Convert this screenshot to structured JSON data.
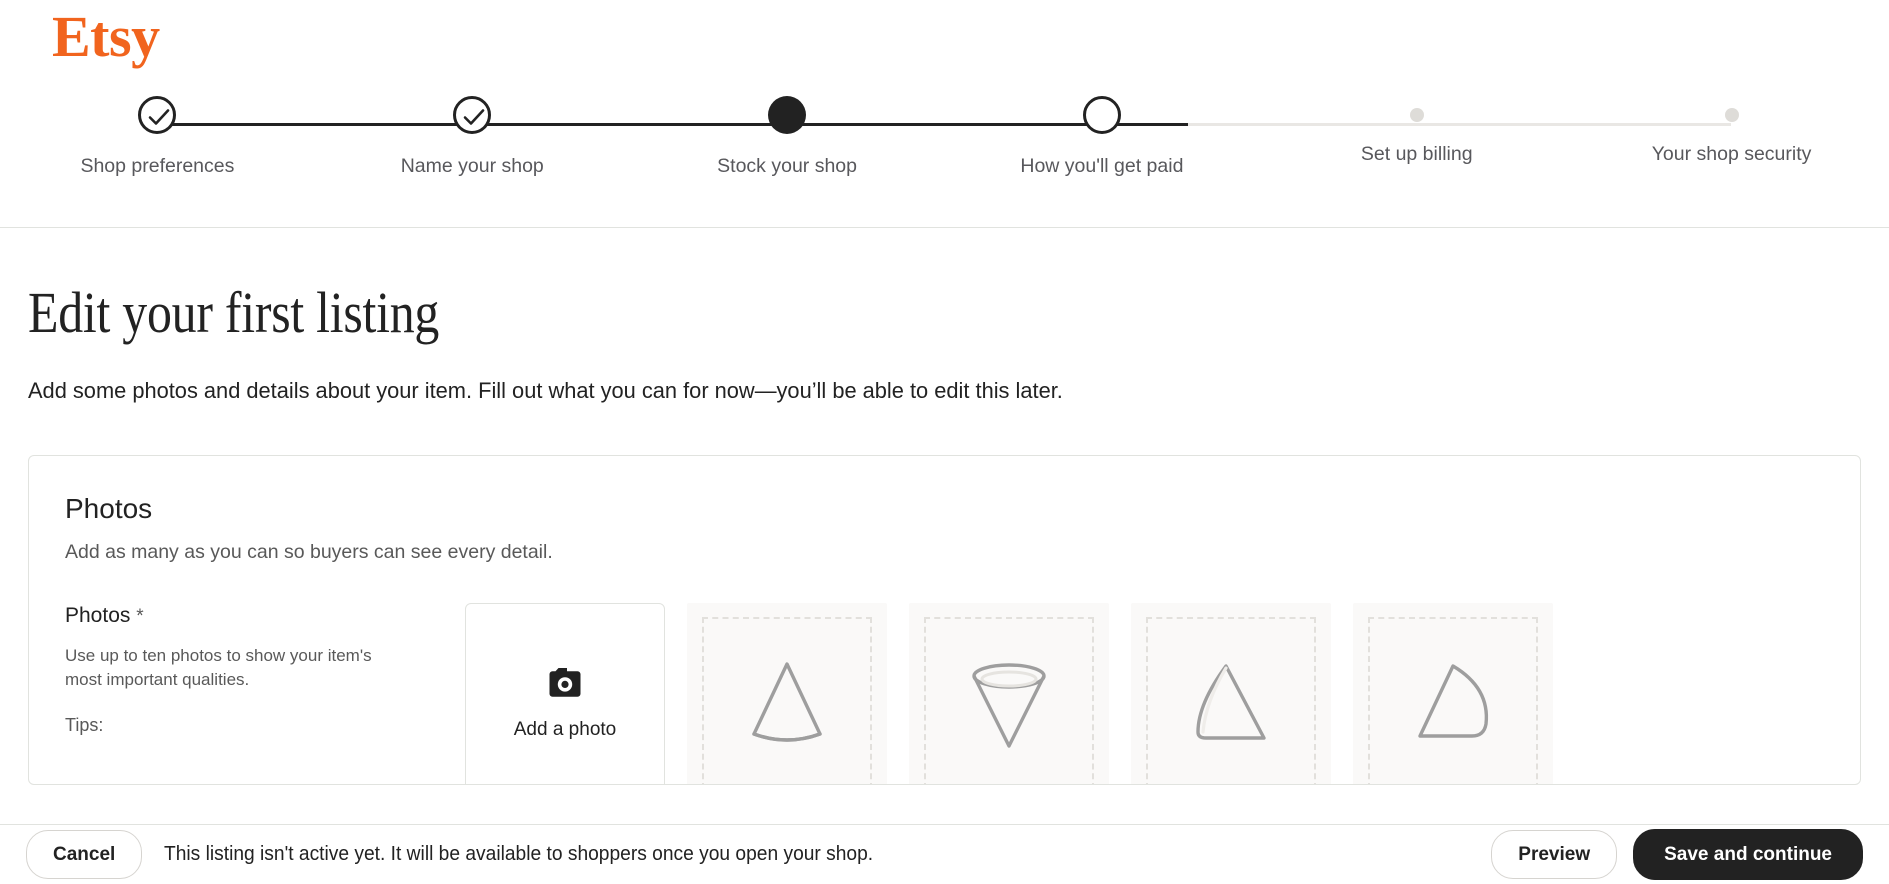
{
  "brand": {
    "name": "Etsy",
    "color": "#F1641E"
  },
  "stepper": {
    "steps": [
      {
        "label": "Shop preferences",
        "state": "complete"
      },
      {
        "label": "Name your shop",
        "state": "complete"
      },
      {
        "label": "Stock your shop",
        "state": "current"
      },
      {
        "label": "How you'll get paid",
        "state": "next"
      },
      {
        "label": "Set up billing",
        "state": "future"
      },
      {
        "label": "Your shop security",
        "state": "future"
      }
    ]
  },
  "page": {
    "title": "Edit your first listing",
    "subtitle": "Add some photos and details about your item. Fill out what you can for now—you’ll be able to edit this later."
  },
  "photos_card": {
    "title": "Photos",
    "description": "Add as many as you can so buyers can see every detail.",
    "field": {
      "label": "Photos",
      "required_mark": "*",
      "help": "Use up to ten photos to show your item's most important qualities.",
      "tips_label": "Tips:"
    },
    "upload": {
      "icon": "camera-icon",
      "label": "Add a photo"
    },
    "placeholders": [
      {
        "shape": "cone-upright-icon"
      },
      {
        "shape": "cone-inverted-icon"
      },
      {
        "shape": "cone-tilted-icon"
      },
      {
        "shape": "cone-leaning-icon"
      }
    ]
  },
  "bottom_bar": {
    "cancel_label": "Cancel",
    "note": "This listing isn't active yet. It will be available to shoppers once you open your shop.",
    "preview_label": "Preview",
    "save_label": "Save and continue"
  }
}
